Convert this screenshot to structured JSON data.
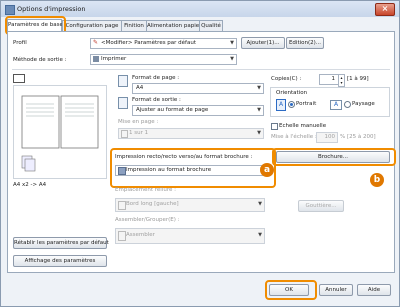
{
  "window": {
    "title": "Options d'impression"
  },
  "tabs": [
    {
      "label": "Paramètres de base"
    },
    {
      "label": "Configuration page"
    },
    {
      "label": "Finition"
    },
    {
      "label": "Alimentation papier"
    },
    {
      "label": "Qualité"
    }
  ],
  "profile": {
    "label": "Profil",
    "value": "<Modifier> Paramètres par défaut",
    "add_button": "Ajouter(1)...",
    "edit_button": "Edition(2)..."
  },
  "output": {
    "label": "Méthode de sortie :",
    "value": "Imprimer"
  },
  "preview": {
    "caption": "A4 x2 -> A4"
  },
  "page_size": {
    "label": "Format de page :",
    "value": "A4"
  },
  "output_size": {
    "label": "Format de sortie :",
    "value": "Ajuster au format de page"
  },
  "layout": {
    "label": "Mise en page :",
    "value": "1 sur 1"
  },
  "copies": {
    "label": "Copies(C) :",
    "value": "1",
    "range": "[1 à 99]"
  },
  "orientation": {
    "label": "Orientation",
    "portrait": "Portrait",
    "landscape": "Paysage",
    "selected": "Portrait"
  },
  "manual_scaling": {
    "label": "Echelle manuelle",
    "zoom_label": "Mise à l'échelle :",
    "zoom_value": "100",
    "zoom_range": "% [25 à 200]"
  },
  "duplex": {
    "label": "Impression recto/recto verso/au format brochure :",
    "value": "Impression au format brochure"
  },
  "booklet_button": "Brochure...",
  "binding": {
    "label": "Emplacement reliure :",
    "value": "Bord long [gauche]"
  },
  "gutter_button": "Gouttière...",
  "collate": {
    "label": "Assembler/Grouper(E) :",
    "value": "Assembler"
  },
  "side_buttons": {
    "display_settings": "Affichage des paramètres",
    "restore_defaults": "Rétablir les paramètres par défaut"
  },
  "badges": {
    "a": "a",
    "b": "b"
  },
  "footer": {
    "ok": "OK",
    "cancel": "Annuler",
    "help": "Aide"
  },
  "colors": {
    "highlight": "#f08c00",
    "badge": "#e07800",
    "selection": "#2c6bc4"
  }
}
